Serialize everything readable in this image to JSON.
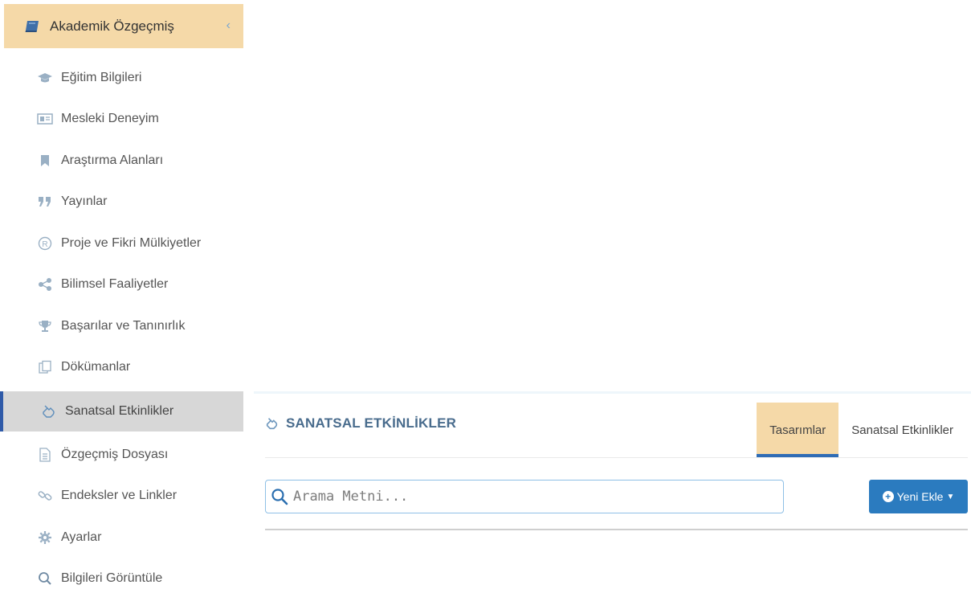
{
  "sidebar": {
    "header": {
      "label": "Akademik Özgeçmiş",
      "collapse_glyph": "‹",
      "icon": "book-icon"
    },
    "items": [
      {
        "label": "Eğitim Bilgileri",
        "icon": "graduation-cap-icon",
        "active": false
      },
      {
        "label": "Mesleki Deneyim",
        "icon": "id-card-icon",
        "active": false
      },
      {
        "label": "Araştırma Alanları",
        "icon": "bookmark-icon",
        "active": false
      },
      {
        "label": "Yayınlar",
        "icon": "quote-icon",
        "active": false
      },
      {
        "label": "Proje ve Fikri Mülkiyetler",
        "icon": "registered-icon",
        "active": false
      },
      {
        "label": "Bilimsel Faaliyetler",
        "icon": "share-icon",
        "active": false
      },
      {
        "label": "Başarılar ve Tanınırlık",
        "icon": "trophy-icon",
        "active": false
      },
      {
        "label": "Dökümanlar",
        "icon": "documents-icon",
        "active": false
      },
      {
        "label": "Sanatsal Etkinlikler",
        "icon": "pointing-hand-icon",
        "active": true
      },
      {
        "label": "Özgeçmiş Dosyası",
        "icon": "file-text-icon",
        "active": false
      },
      {
        "label": "Endeksler ve Linkler",
        "icon": "link-icon",
        "active": false
      },
      {
        "label": "Ayarlar",
        "icon": "gear-icon",
        "active": false
      },
      {
        "label": "Bilgileri Görüntüle",
        "icon": "search-icon",
        "active": false
      }
    ]
  },
  "panel": {
    "title": "SANATSAL ETKİNLİKLER",
    "tabs": [
      {
        "label": "Tasarımlar",
        "active": true
      },
      {
        "label": "Sanatsal Etkinlikler",
        "active": false
      }
    ],
    "search": {
      "placeholder": "Arama Metni..."
    },
    "add_button": {
      "label": "Yeni Ekle"
    }
  },
  "colors": {
    "accent_beige": "#f5d9a8",
    "primary_blue": "#2b7bbf",
    "active_border": "#2f5aa8",
    "title_blue": "#496c8d"
  }
}
